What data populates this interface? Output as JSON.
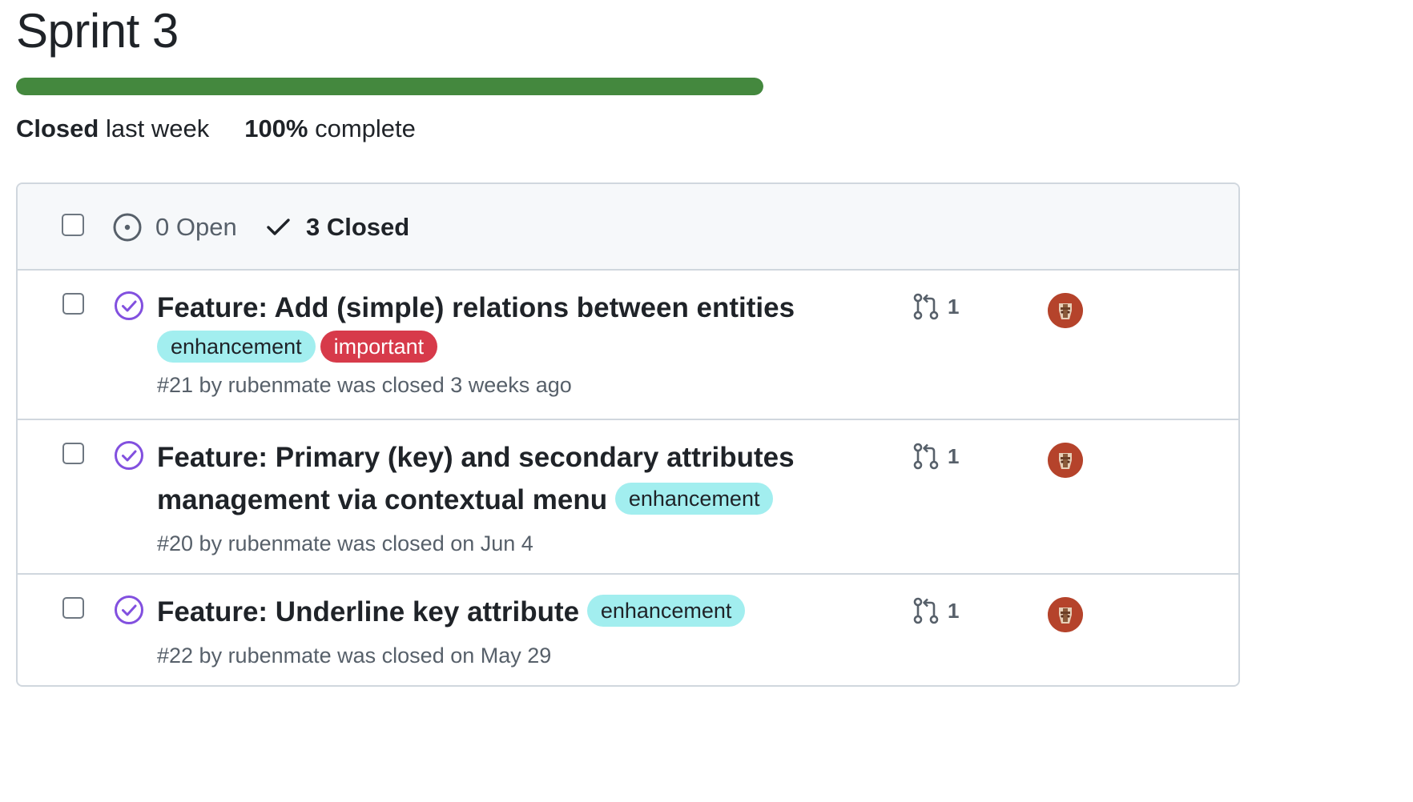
{
  "milestone": {
    "title": "Sprint 3",
    "progress_percent": 100,
    "progress_color": "#44883e",
    "status_strong": "Closed",
    "status_rest": " last week",
    "complete_strong": "100%",
    "complete_rest": " complete"
  },
  "header": {
    "open_label": "0 Open",
    "closed_label": "3 Closed"
  },
  "issues": [
    {
      "title": "Feature: Add (simple) relations between entities",
      "labels": [
        {
          "text": "enhancement",
          "bg": "#a2eeef",
          "fg": "#1f2328"
        },
        {
          "text": "important",
          "bg": "#d73a4a",
          "fg": "#ffffff"
        }
      ],
      "meta": "#21 by rubenmate was closed 3 weeks ago",
      "linked_prs": "1",
      "avatar_icon": "user-avatar"
    },
    {
      "title": "Feature: Primary (key) and secondary attributes management via contextual menu",
      "labels": [
        {
          "text": "enhancement",
          "bg": "#a2eeef",
          "fg": "#1f2328"
        }
      ],
      "meta": "#20 by rubenmate was closed on Jun 4",
      "linked_prs": "1",
      "avatar_icon": "user-avatar"
    },
    {
      "title": "Feature: Underline key attribute",
      "labels": [
        {
          "text": "enhancement",
          "bg": "#a2eeef",
          "fg": "#1f2328"
        }
      ],
      "meta": "#22 by rubenmate was closed on May 29",
      "linked_prs": "1",
      "avatar_icon": "user-avatar"
    }
  ],
  "icons": {
    "open": "circle-dot-icon",
    "closed_filter": "check-icon",
    "issue_closed": "issue-closed-icon",
    "pull_request": "git-pull-request-icon"
  },
  "colors": {
    "closed_purple": "#8250df",
    "muted": "#57606a",
    "border": "#d0d7de"
  }
}
